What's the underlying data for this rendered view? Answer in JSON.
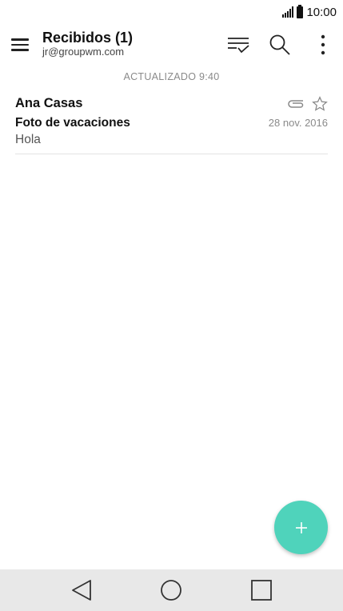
{
  "status_bar": {
    "time": "10:00"
  },
  "app_bar": {
    "title": "Recibidos (1)",
    "account": "jr@groupwm.com"
  },
  "list": {
    "updated_label": "ACTUALIZADO 9:40",
    "emails": [
      {
        "sender": "Ana Casas",
        "subject": "Foto de vacaciones",
        "preview": "Hola",
        "date": "28 nov. 2016",
        "has_attachment": true,
        "starred": false
      }
    ]
  },
  "fab": {
    "icon": "plus-icon",
    "color": "#4fd3bb"
  },
  "nav_bar": {
    "icons": [
      "back-icon",
      "home-icon",
      "recents-icon"
    ]
  }
}
